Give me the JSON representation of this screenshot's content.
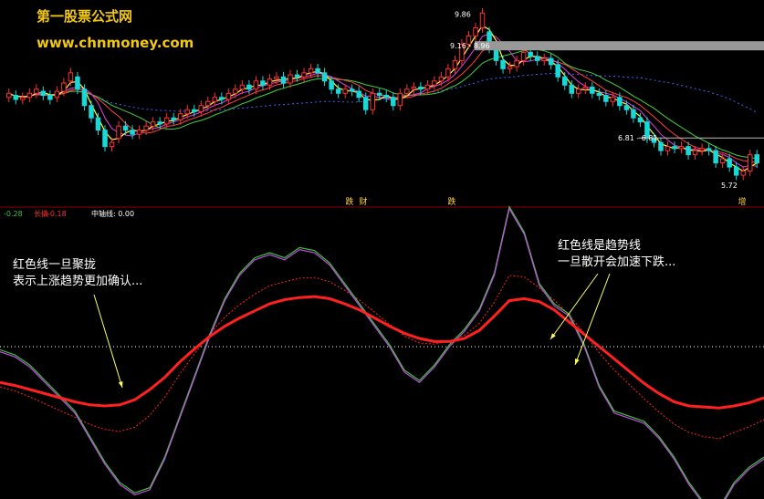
{
  "watermark": {
    "site_name": "第一股票公式网",
    "url": "www.chnmoney.com"
  },
  "colors": {
    "background": "#000000",
    "up_candle": "#ff3030",
    "down_candle": "#18d8d8",
    "ma_fast": "#ffff40",
    "ma_mid": "#e040e0",
    "ma_slow": "#ff4040",
    "ma_long": "#40d040",
    "ma_dotted": "#4060ff",
    "osc_purple": "#c050e0",
    "osc_green": "#40c040",
    "trend_red": "#ff2020",
    "arrow": "#ffff60",
    "annotation_text": "#ffffff",
    "zero_line": "#ffffff",
    "panel_border": "#8b0000"
  },
  "chart_data": [
    {
      "type": "candlestick",
      "ylim": [
        5.5,
        10.0
      ],
      "price_labels": [
        {
          "label": "9.86",
          "value": 9.86
        },
        {
          "label": "9.16 - 8.96",
          "value": 9.06
        },
        {
          "label": "6.81 - 6.81",
          "value": 6.81
        },
        {
          "label": "5.72",
          "value": 5.72
        }
      ],
      "signal_markers": [
        "跌",
        "财",
        "跌",
        "增"
      ],
      "candles_open_close": [
        [
          7.8,
          7.9
        ],
        [
          7.85,
          7.75
        ],
        [
          7.75,
          7.8
        ],
        [
          7.8,
          7.9
        ],
        [
          7.9,
          8.0
        ],
        [
          7.95,
          7.85
        ],
        [
          7.85,
          7.75
        ],
        [
          7.8,
          7.95
        ],
        [
          7.95,
          8.15
        ],
        [
          8.2,
          8.4
        ],
        [
          8.3,
          8.0
        ],
        [
          8.0,
          7.6
        ],
        [
          7.6,
          7.3
        ],
        [
          7.3,
          7.0
        ],
        [
          7.0,
          6.6
        ],
        [
          6.6,
          6.7
        ],
        [
          6.8,
          7.1
        ],
        [
          7.1,
          7.0
        ],
        [
          7.0,
          6.9
        ],
        [
          6.9,
          7.0
        ],
        [
          7.0,
          7.1
        ],
        [
          7.1,
          7.2
        ],
        [
          7.2,
          7.15
        ],
        [
          7.15,
          7.3
        ],
        [
          7.3,
          7.25
        ],
        [
          7.25,
          7.4
        ],
        [
          7.4,
          7.5
        ],
        [
          7.5,
          7.45
        ],
        [
          7.45,
          7.6
        ],
        [
          7.6,
          7.7
        ],
        [
          7.7,
          7.8
        ],
        [
          7.8,
          7.75
        ],
        [
          7.75,
          7.9
        ],
        [
          7.9,
          8.0
        ],
        [
          8.0,
          8.1
        ],
        [
          8.1,
          8.0
        ],
        [
          8.0,
          8.2
        ],
        [
          8.2,
          8.1
        ],
        [
          8.1,
          8.25
        ],
        [
          8.25,
          8.3
        ],
        [
          8.3,
          8.15
        ],
        [
          8.15,
          8.35
        ],
        [
          8.35,
          8.3
        ],
        [
          8.3,
          8.4
        ],
        [
          8.4,
          8.5
        ],
        [
          8.5,
          8.4
        ],
        [
          8.4,
          8.2
        ],
        [
          8.2,
          8.0
        ],
        [
          8.0,
          7.9
        ],
        [
          7.9,
          8.0
        ],
        [
          8.0,
          7.95
        ],
        [
          7.95,
          7.8
        ],
        [
          7.8,
          7.5
        ],
        [
          7.5,
          7.9
        ],
        [
          7.9,
          7.85
        ],
        [
          7.85,
          7.8
        ],
        [
          7.8,
          7.6
        ],
        [
          7.6,
          7.9
        ],
        [
          7.9,
          8.0
        ],
        [
          8.0,
          8.05
        ],
        [
          8.05,
          8.0
        ],
        [
          8.0,
          8.1
        ],
        [
          8.1,
          8.2
        ],
        [
          8.2,
          8.3
        ],
        [
          8.3,
          8.5
        ],
        [
          8.5,
          8.7
        ],
        [
          8.7,
          9.1
        ],
        [
          9.1,
          9.3
        ],
        [
          9.3,
          9.5
        ],
        [
          9.5,
          9.86
        ],
        [
          9.4,
          9.0
        ],
        [
          9.0,
          8.7
        ],
        [
          8.7,
          8.5
        ],
        [
          8.5,
          8.55
        ],
        [
          8.55,
          8.7
        ],
        [
          8.7,
          8.9
        ],
        [
          8.9,
          8.8
        ],
        [
          8.8,
          8.7
        ],
        [
          8.7,
          8.75
        ],
        [
          8.75,
          8.6
        ],
        [
          8.6,
          8.3
        ],
        [
          8.3,
          8.1
        ],
        [
          8.1,
          7.9
        ],
        [
          7.9,
          8.0
        ],
        [
          8.0,
          8.05
        ],
        [
          8.05,
          7.9
        ],
        [
          7.9,
          7.85
        ],
        [
          7.85,
          7.7
        ],
        [
          7.7,
          7.8
        ],
        [
          7.8,
          7.6
        ],
        [
          7.6,
          7.5
        ],
        [
          7.5,
          7.3
        ],
        [
          7.3,
          7.2
        ],
        [
          7.2,
          6.8
        ],
        [
          6.8,
          6.7
        ],
        [
          6.7,
          6.5
        ],
        [
          6.5,
          6.6
        ],
        [
          6.6,
          6.55
        ],
        [
          6.55,
          6.6
        ],
        [
          6.6,
          6.4
        ],
        [
          6.4,
          6.5
        ],
        [
          6.5,
          6.55
        ],
        [
          6.55,
          6.5
        ],
        [
          6.5,
          6.2
        ],
        [
          6.2,
          6.3
        ],
        [
          6.3,
          6.1
        ],
        [
          6.1,
          5.9
        ],
        [
          5.9,
          6.0
        ],
        [
          6.0,
          6.4
        ],
        [
          6.4,
          6.2
        ]
      ]
    },
    {
      "type": "line",
      "series": [
        {
          "name": "长线",
          "color": "#c050e0",
          "values": [
            -0.05,
            -0.1,
            -0.2,
            -0.35,
            -0.5,
            -0.65,
            -0.9,
            -1.15,
            -1.35,
            -1.45,
            -1.4,
            -1.1,
            -0.7,
            -0.3,
            0.1,
            0.45,
            0.7,
            0.85,
            0.9,
            0.85,
            0.95,
            0.92,
            0.8,
            0.6,
            0.4,
            0.2,
            0.0,
            -0.25,
            -0.35,
            -0.2,
            0.0,
            0.15,
            0.35,
            0.7,
            1.35,
            1.1,
            0.6,
            0.4,
            0.3,
            0.0,
            -0.4,
            -0.65,
            -0.7,
            -0.75,
            -0.9,
            -1.1,
            -1.35,
            -1.55,
            -1.6,
            -1.35,
            -1.2,
            -1.1
          ]
        }
      ],
      "trend_line": [
        -0.35,
        -0.38,
        -0.42,
        -0.46,
        -0.5,
        -0.54,
        -0.57,
        -0.58,
        -0.57,
        -0.52,
        -0.42,
        -0.3,
        -0.15,
        -0.02,
        0.1,
        0.2,
        0.28,
        0.35,
        0.42,
        0.46,
        0.48,
        0.49,
        0.47,
        0.42,
        0.36,
        0.28,
        0.2,
        0.13,
        0.08,
        0.05,
        0.05,
        0.08,
        0.16,
        0.3,
        0.45,
        0.47,
        0.44,
        0.36,
        0.24,
        0.12,
        0.0,
        -0.12,
        -0.24,
        -0.36,
        -0.46,
        -0.54,
        -0.58,
        -0.59,
        -0.6,
        -0.58,
        -0.55,
        -0.5
      ],
      "legend": [
        {
          "label": "-0.28",
          "color": "#40c040"
        },
        {
          "label": "长撬",
          "color": "#ff3030"
        },
        {
          "label": "-0.18",
          "color": "#ff3030"
        },
        {
          "label": "中轴线: 0.00",
          "color": "#ffffff"
        }
      ],
      "annotations": [
        {
          "lines": [
            "红色线一旦聚拢",
            "表示上涨趋势更加确认..."
          ]
        },
        {
          "lines": [
            "红色线是趋势线",
            "一旦散开会加速下跌..."
          ]
        }
      ]
    }
  ]
}
